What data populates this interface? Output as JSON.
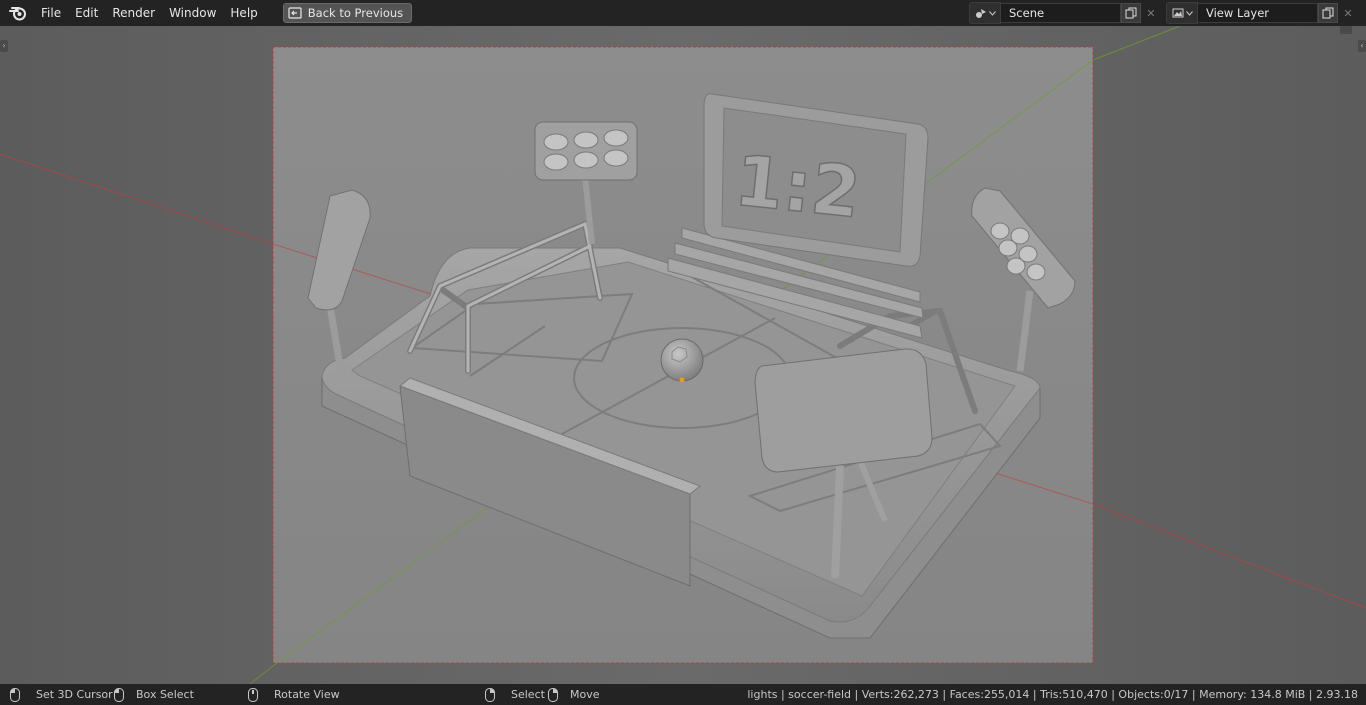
{
  "menu": {
    "items": [
      "File",
      "Edit",
      "Render",
      "Window",
      "Help"
    ],
    "back_button": "Back to Previous"
  },
  "scene_selector": {
    "value": "Scene"
  },
  "view_layer_selector": {
    "value": "View Layer"
  },
  "viewport": {
    "scoreboard_text": "1:2"
  },
  "statusbar": {
    "hints": [
      {
        "label": "Set 3D Cursor"
      },
      {
        "label": "Box Select"
      },
      {
        "label": "Rotate View"
      },
      {
        "label": "Select"
      },
      {
        "label": "Move"
      }
    ],
    "stats": "lights | soccer-field | Verts:262,273 | Faces:255,014 | Tris:510,470 | Objects:0/17 | Memory: 134.8 MiB | 2.93.18"
  },
  "colors": {
    "topbar_bg": "#232323",
    "viewport_bg": "#636363",
    "render_region_bg": "#8a8a8a",
    "x_axis": "#b34a4a",
    "y_axis": "#6b8e3a"
  }
}
